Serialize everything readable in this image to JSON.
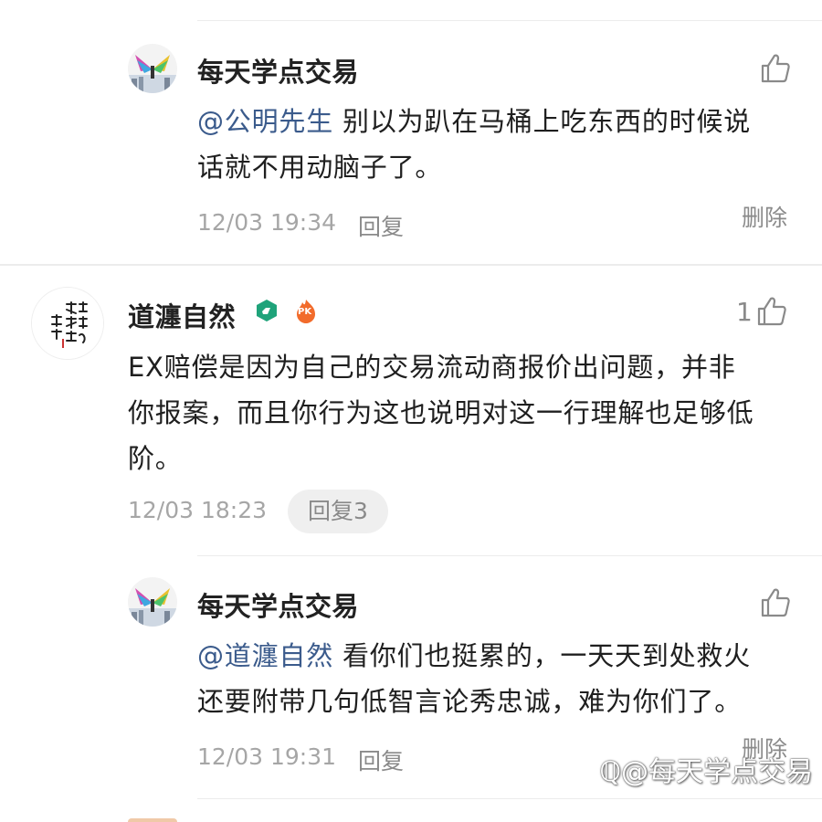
{
  "comments": [
    {
      "author": "每天学点交易",
      "mention": "@公明先生",
      "text_line1": " 别以为趴在马桶上吃东西的时候说",
      "text_line2": "话就不用动脑子了。",
      "time": "12/03 19:34",
      "reply_label": "回复",
      "delete_label": "删除"
    },
    {
      "author": "道瀍自然",
      "like_count": "1",
      "text_line1": "EX赔偿是因为自己的交易流动商报价出问题，并非",
      "text_line2": "你报案，而且你行为这也说明对这一行理解也足够低",
      "text_line3": "阶。",
      "time": "12/03 18:23",
      "reply_label": "回复3",
      "badge_pk": "PK"
    },
    {
      "author": "每天学点交易",
      "mention": "@道瀍自然",
      "text_line1": " 看你们也挺累的，一天天到处救火",
      "text_line2": "还要附带几句低智言论秀忠诚，难为你们了。",
      "time": "12/03 19:31",
      "reply_label": "回复",
      "delete_label": "删除"
    }
  ],
  "watermark": "@每天学点交易",
  "colors": {
    "mention": "#3b5b8c",
    "meta": "#a6a6a6",
    "badge_green": "#1fa37a",
    "badge_orange": "#f26b2b"
  }
}
